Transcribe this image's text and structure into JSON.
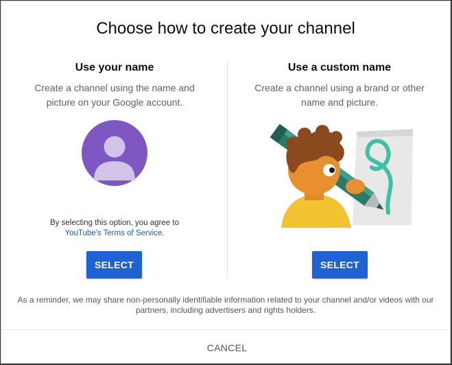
{
  "dialog": {
    "title": "Choose how to create your channel",
    "cancel_label": "CANCEL",
    "reminder": "As a reminder, we may share non-personally identifiable information related to your channel and/or videos with our partners, including advertisers and rights holders."
  },
  "option_name": {
    "heading": "Use your name",
    "description": "Create a channel using the name and picture on your Google account.",
    "agree_text": "By selecting this option, you agree to",
    "tos_link": "YouTube's Terms of Service",
    "tos_suffix": ".",
    "select_label": "SELECT",
    "avatar_icon": "default-avatar-icon"
  },
  "option_custom": {
    "heading": "Use a custom name",
    "description": "Create a channel using a brand or other name and picture.",
    "select_label": "SELECT",
    "illustration": "artist-with-pencil-illustration"
  },
  "colors": {
    "primary_button": "#1f62d1",
    "link": "#1a56c4",
    "avatar_bg": "#7e57c2",
    "avatar_figure": "#d1c4e9"
  }
}
